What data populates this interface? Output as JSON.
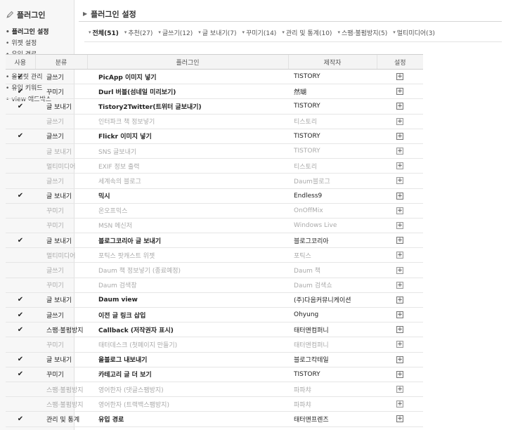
{
  "sidebar": {
    "title": "플러그인",
    "items": [
      {
        "label": "플러그인 설정",
        "active": true
      },
      {
        "label": "위젯 설정",
        "active": false
      },
      {
        "label": "유입 경로",
        "active": false
      },
      {
        "label": "방문자 통계",
        "active": false
      },
      {
        "label": "올블릿 관리",
        "active": false
      },
      {
        "label": "유입 키워드",
        "active": false
      },
      {
        "label": "view 애드박스",
        "active": false
      }
    ]
  },
  "header": {
    "title": "플러그인 설정"
  },
  "filters": [
    {
      "label": "전체(51)",
      "active": true
    },
    {
      "label": "추천(27)",
      "active": false
    },
    {
      "label": "글쓰기(12)",
      "active": false
    },
    {
      "label": "글 보내기(7)",
      "active": false
    },
    {
      "label": "꾸미기(14)",
      "active": false
    },
    {
      "label": "관리 및 통계(10)",
      "active": false
    },
    {
      "label": "스팸·불펌방지(5)",
      "active": false
    },
    {
      "label": "멀티미디어(3)",
      "active": false
    }
  ],
  "table": {
    "columns": [
      "사용",
      "분류",
      "플러그인",
      "제작자",
      "설정"
    ],
    "check_symbol": "✔",
    "setting_symbol": "+",
    "rows": [
      {
        "on": true,
        "category": "글쓰기",
        "name": "PicApp 이미지 넣기",
        "maker": "TISTORY"
      },
      {
        "on": true,
        "category": "꾸미기",
        "name": "Durl 버블(섬네일 미리보기)",
        "maker": "然瑚"
      },
      {
        "on": true,
        "category": "글 보내기",
        "name": "Tistory2Twitter(트위터 글보내기)",
        "maker": "TISTORY"
      },
      {
        "on": false,
        "category": "글쓰기",
        "name": "인터파크 책 정보넣기",
        "maker": "티스토리"
      },
      {
        "on": true,
        "category": "글쓰기",
        "name": "Flickr 이미지 넣기",
        "maker": "TISTORY"
      },
      {
        "on": false,
        "category": "글 보내기",
        "name": "SNS 글보내기",
        "maker": "TISTORY"
      },
      {
        "on": false,
        "category": "멀티미디어",
        "name": "EXIF 정보 출력",
        "maker": "티스토리"
      },
      {
        "on": false,
        "category": "글쓰기",
        "name": "세계속의 블로그",
        "maker": "Daum블로그"
      },
      {
        "on": true,
        "category": "글 보내기",
        "name": "믹시",
        "maker": "Endless9"
      },
      {
        "on": false,
        "category": "꾸미기",
        "name": "온오프믹스",
        "maker": "OnOffMix"
      },
      {
        "on": false,
        "category": "꾸미기",
        "name": "MSN 메신저",
        "maker": "Windows Live"
      },
      {
        "on": true,
        "category": "글 보내기",
        "name": "블로그코리아 글 보내기",
        "maker": "블로그코리아"
      },
      {
        "on": false,
        "category": "멀티미디어",
        "name": "포틱스 팟캐스트 위젯",
        "maker": "포틱스"
      },
      {
        "on": false,
        "category": "글쓰기",
        "name": "Daum 책 정보넣기 (종료예정)",
        "maker": "Daum 책"
      },
      {
        "on": false,
        "category": "꾸미기",
        "name": "Daum 검색창",
        "maker": "Daum 검색쇼"
      },
      {
        "on": true,
        "category": "글 보내기",
        "name": "Daum view",
        "maker": "(주)다음커뮤니케이션"
      },
      {
        "on": true,
        "category": "글쓰기",
        "name": "이전 글 링크 삽입",
        "maker": "Ohyung"
      },
      {
        "on": true,
        "category": "스팸·불펌방지",
        "name": "Callback (저작권자 표시)",
        "maker": "태터앤컴퍼니"
      },
      {
        "on": false,
        "category": "꾸미기",
        "name": "태터데스크 (첫페이지 만들기)",
        "maker": "태터앤컴퍼니"
      },
      {
        "on": true,
        "category": "글 보내기",
        "name": "올블로그 내보내기",
        "maker": "블로그칵테일"
      },
      {
        "on": true,
        "category": "꾸미기",
        "name": "카테고리 글 더 보기",
        "maker": "TISTORY"
      },
      {
        "on": false,
        "category": "스팸·불펌방지",
        "name": "영어한자 (댓글스팸방지)",
        "maker": "파파챠"
      },
      {
        "on": false,
        "category": "스팸·불펌방지",
        "name": "영어한자 (트랙백스팸방지)",
        "maker": "파파챠"
      },
      {
        "on": true,
        "category": "관리 및 통계",
        "name": "유입 경로",
        "maker": "태터앤프렌즈"
      }
    ]
  },
  "colors": {
    "check": "#2a7a8a",
    "header_bg": "#f4f4f4",
    "sidebar_bg": "#f7f7f7"
  },
  "icons": {
    "sidebar": "plugin-pen-icon",
    "setting": "plus-box-icon",
    "use": "checkmark-icon"
  }
}
